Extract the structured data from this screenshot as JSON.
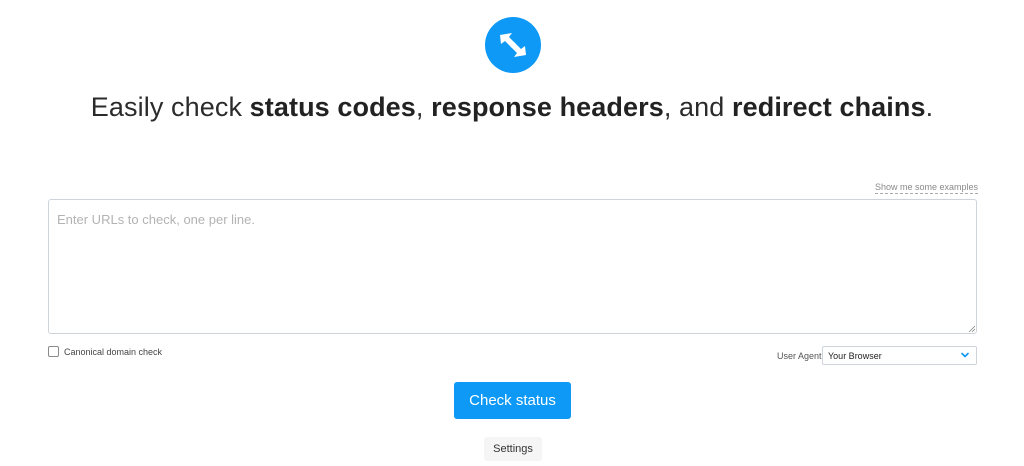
{
  "logo": {
    "icon": "redirect-arrows-icon",
    "color": "#0d99f5"
  },
  "headline": {
    "prefix": "Easily check ",
    "term1": "status codes",
    "sep1": ", ",
    "term2": "response headers",
    "sep2": ", and ",
    "term3": "redirect chains",
    "suffix": "."
  },
  "examples_link": "Show me some examples",
  "url_input": {
    "placeholder": "Enter URLs to check, one per line.",
    "value": ""
  },
  "canonical_check": {
    "label": "Canonical domain check",
    "checked": false
  },
  "user_agent": {
    "label": "User Agent:",
    "selected": "Your Browser",
    "icon": "chevron-down-icon"
  },
  "check_button": {
    "label": "Check status",
    "color": "#0d99f5"
  },
  "settings_button": {
    "label": "Settings"
  }
}
